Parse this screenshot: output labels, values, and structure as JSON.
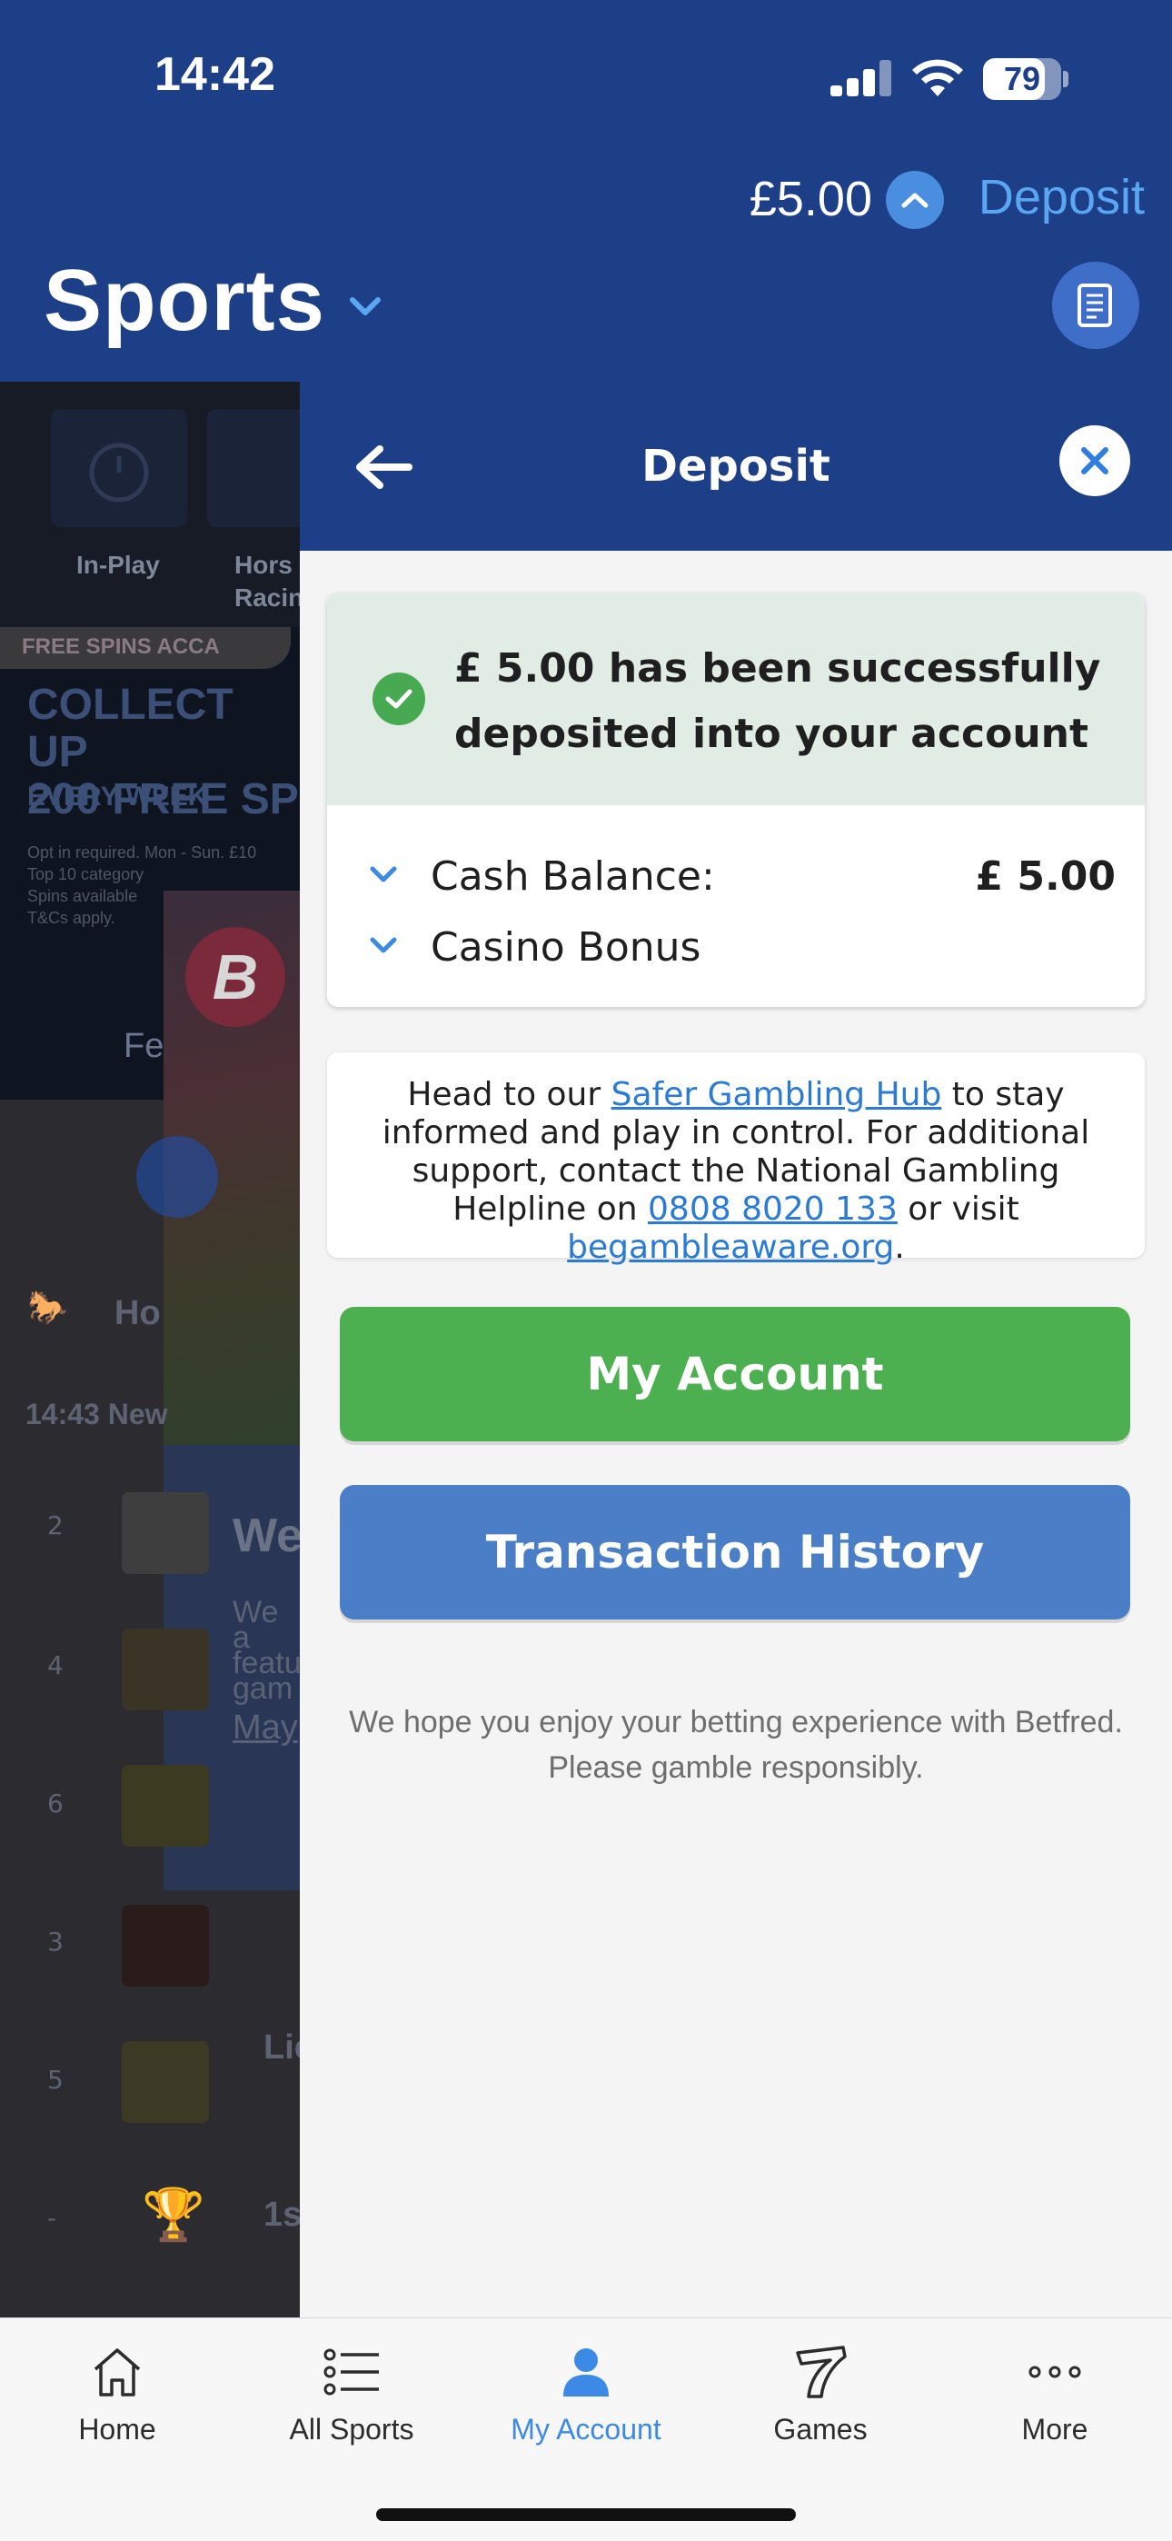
{
  "status_bar": {
    "time": "14:42",
    "battery": "79",
    "battery_level": 0.79
  },
  "header": {
    "balance": "£5.00",
    "deposit_label": "Deposit",
    "section_title": "Sports"
  },
  "background_page": {
    "nav": [
      "In-Play",
      "Hors",
      "Racin"
    ],
    "promo_tag": "FREE SPINS ACCA",
    "promo_big": [
      "COLLECT UP",
      "200 FREE SP"
    ],
    "promo_small": "EVERY WEEK",
    "promo_fine": [
      "Opt in required. Mon - Sun. £10",
      "Top 10 category",
      "Spins available",
      "T&Cs apply."
    ],
    "promo_fe": "Fe",
    "card_badge": "B",
    "card_heading": "We",
    "card_text": [
      "We a",
      "featu",
      "gam"
    ],
    "card_link": "May",
    "section_row": "Ho",
    "race_row": "14:43 New",
    "runner_numbers": [
      "2",
      "4",
      "6",
      "3",
      "5",
      "-"
    ],
    "runner_names": [
      "Lic",
      "1s"
    ]
  },
  "drawer": {
    "title": "Deposit",
    "success_message": "£ 5.00 has been successfully deposited into your account",
    "cash_balance_label": "Cash Balance:",
    "cash_balance_value": "£ 5.00",
    "casino_bonus_label": "Casino Bonus",
    "info_prefix": "Head to our ",
    "safer_link": "Safer Gambling Hub",
    "info_middle": " to stay informed and play in control. For additional support, contact the National Gambling Helpline on ",
    "helpline_link": "0808 8020 133",
    "info_or": " or visit ",
    "aware_link": "begambleaware.org",
    "info_end": ".",
    "my_account_button": "My Account",
    "transaction_history_button": "Transaction History",
    "footer_note": "We hope you enjoy your betting experience with Betfred. Please gamble responsibly."
  },
  "tabbar": {
    "items": [
      {
        "label": "Home",
        "icon": "home-icon"
      },
      {
        "label": "All Sports",
        "icon": "list-icon"
      },
      {
        "label": "My Account",
        "icon": "person-icon",
        "active": true
      },
      {
        "label": "Games",
        "icon": "slot-seven-icon"
      },
      {
        "label": "More",
        "icon": "more-dots-icon"
      }
    ]
  },
  "colors": {
    "header_blue": "#1d3f87",
    "accent_link": "#5aa6f2",
    "success_green": "#4caf50",
    "history_blue": "#4a7ec7",
    "active_tab": "#3c8ae6"
  }
}
